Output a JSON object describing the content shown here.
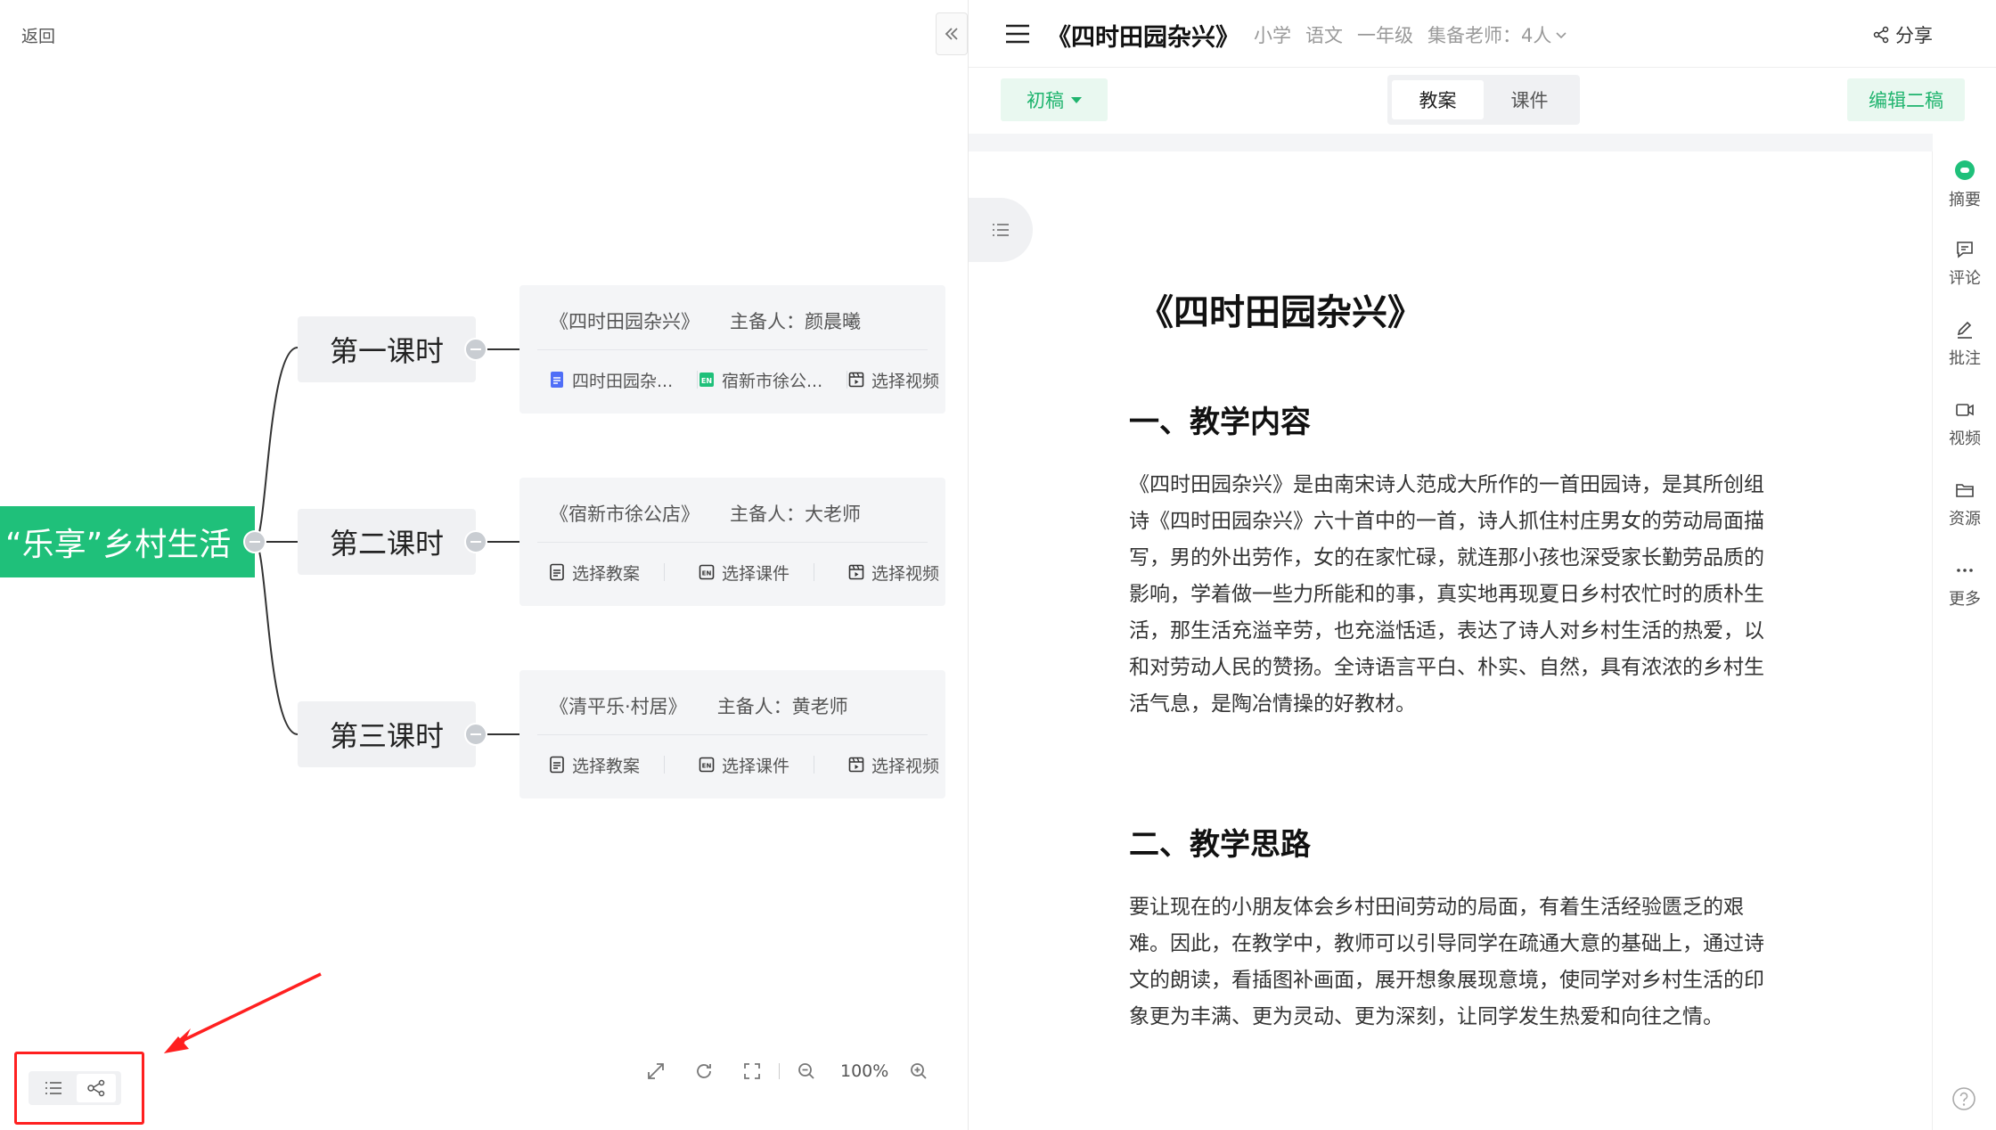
{
  "left": {
    "back_label": "返回",
    "root_label": "“乐享”乡村生活",
    "lessons": [
      {
        "label": "第一课时",
        "card_title": "《四时田园杂兴》",
        "owner": "主备人：颜晨曦",
        "resources": [
          {
            "label": "四时田园杂...",
            "icon": "doc-blue-icon"
          },
          {
            "label": "宿新市徐公...",
            "icon": "ppt-green-icon"
          },
          {
            "label": "选择视频",
            "icon": "video-outline-icon"
          }
        ]
      },
      {
        "label": "第二课时",
        "card_title": "《宿新市徐公店》",
        "owner": "主备人：大老师",
        "resources": [
          {
            "label": "选择教案",
            "icon": "doc-outline-icon"
          },
          {
            "label": "选择课件",
            "icon": "ppt-outline-icon"
          },
          {
            "label": "选择视频",
            "icon": "video-outline-icon"
          }
        ]
      },
      {
        "label": "第三课时",
        "card_title": "《清平乐·村居》",
        "owner": "主备人：黄老师",
        "resources": [
          {
            "label": "选择教案",
            "icon": "doc-outline-icon"
          },
          {
            "label": "选择课件",
            "icon": "ppt-outline-icon"
          },
          {
            "label": "选择视频",
            "icon": "video-outline-icon"
          }
        ]
      }
    ],
    "zoom": "100%",
    "accent": "#1fc07a",
    "annotation_color": "#ff2020"
  },
  "right": {
    "title": "《四时田园杂兴》",
    "meta": {
      "stage": "小学",
      "subject": "语文",
      "grade": "一年级",
      "teachers": "集备老师：4人"
    },
    "share_label": "分享",
    "draft_label": "初稿",
    "tabs": [
      "教案",
      "课件"
    ],
    "edit_label": "编辑二稿",
    "doc": {
      "heading": "《四时田园杂兴》",
      "sections": [
        {
          "title": "一、教学内容",
          "body": "《四时田园杂兴》是由南宋诗人范成大所作的一首田园诗，是其所创组诗《四时田园杂兴》六十首中的一首，诗人抓住村庄男女的劳动局面描写，男的外出劳作，女的在家忙碌，就连那小孩也深受家长勤劳品质的影响，学着做一些力所能和的事，真实地再现夏日乡村农忙时的质朴生活，那生活充溢辛劳，也充溢恬适，表达了诗人对乡村生活的热爱，以和对劳动人民的赞扬。全诗语言平白、朴实、自然，具有浓浓的乡村生活气息，是陶冶情操的好教材。"
        },
        {
          "title": "二、教学思路",
          "body": "要让现在的小朋友体会乡村田间劳动的局面，有着生活经验匮乏的艰难。因此，在教学中，教师可以引导同学在疏通大意的基础上，通过诗文的朗读，看插图补画面，展开想象展现意境，使同学对乡村生活的印象更为丰满、更为灵动、更为深刻，让同学发生热爱和向往之情。"
        }
      ]
    },
    "side_actions": [
      {
        "label": "摘要",
        "icon": "summary-icon"
      },
      {
        "label": "评论",
        "icon": "comment-icon"
      },
      {
        "label": "批注",
        "icon": "annotate-icon"
      },
      {
        "label": "视频",
        "icon": "video-icon"
      },
      {
        "label": "资源",
        "icon": "folder-icon"
      },
      {
        "label": "更多",
        "icon": "more-icon"
      }
    ]
  }
}
